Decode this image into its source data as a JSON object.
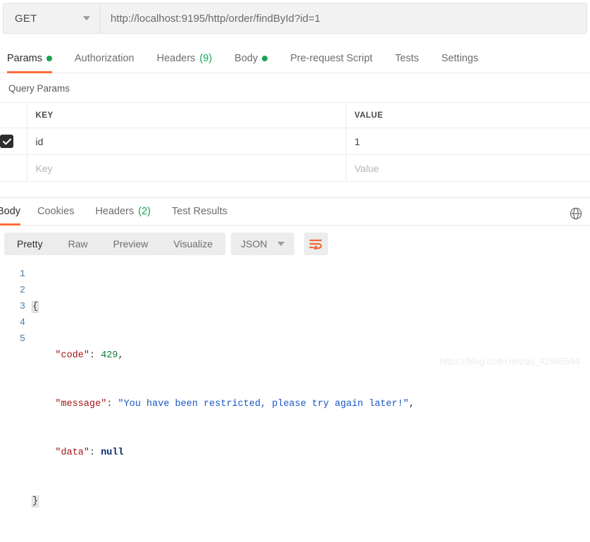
{
  "request": {
    "method": "GET",
    "url": "http://localhost:9195/http/order/findById?id=1",
    "tabs": [
      {
        "label": "Params",
        "dot": true,
        "active": true
      },
      {
        "label": "Authorization",
        "active": false
      },
      {
        "label": "Headers",
        "count": "(9)",
        "active": false
      },
      {
        "label": "Body",
        "dot": true,
        "active": false
      },
      {
        "label": "Pre-request Script",
        "active": false
      },
      {
        "label": "Tests",
        "active": false
      },
      {
        "label": "Settings",
        "active": false
      }
    ]
  },
  "query_params": {
    "title": "Query Params",
    "headers": {
      "key": "KEY",
      "value": "VALUE"
    },
    "rows": [
      {
        "checked": true,
        "key": "id",
        "value": "1",
        "placeholder": false
      },
      {
        "checked": false,
        "key": "Key",
        "value": "Value",
        "placeholder": true
      }
    ]
  },
  "response": {
    "tabs": [
      {
        "label": "Body",
        "active": true
      },
      {
        "label": "Cookies",
        "active": false
      },
      {
        "label": "Headers",
        "count": "(2)",
        "active": false
      },
      {
        "label": "Test Results",
        "active": false
      }
    ],
    "globe_icon": "globe-icon",
    "format_tabs": [
      {
        "label": "Pretty",
        "active": true
      },
      {
        "label": "Raw",
        "active": false
      },
      {
        "label": "Preview",
        "active": false
      },
      {
        "label": "Visualize",
        "active": false
      }
    ],
    "language": "JSON",
    "wrap_icon": "word-wrap-icon",
    "line_numbers": [
      "1",
      "2",
      "3",
      "4",
      "5"
    ],
    "body": {
      "code": "429",
      "message": "You have been restricted, please try again later!",
      "data": "null",
      "keys": {
        "code": "\"code\"",
        "message": "\"message\"",
        "data": "\"data\""
      },
      "message_quoted": "\"You have been restricted, please try again later!\"",
      "open_brace": "{",
      "close_brace": "}"
    }
  },
  "watermark": "https://blog.csdn.net/qq_42965594",
  "colors": {
    "accent": "#ff6c37",
    "success": "#19a351",
    "json_key": "#a31515",
    "json_string": "#1a57c4",
    "json_number": "#0a7c3e",
    "json_null": "#0b2e6b"
  }
}
